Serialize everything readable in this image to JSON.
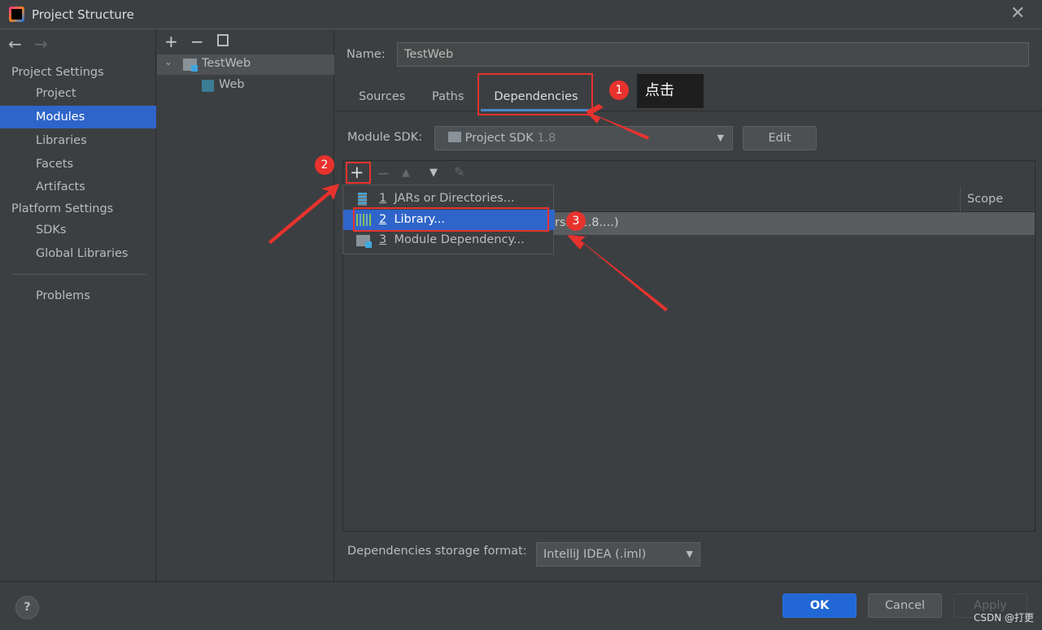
{
  "window": {
    "title": "Project Structure"
  },
  "sidebar": {
    "project_settings": "Project Settings",
    "items": [
      {
        "label": "Project"
      },
      {
        "label": "Modules"
      },
      {
        "label": "Libraries"
      },
      {
        "label": "Facets"
      },
      {
        "label": "Artifacts"
      }
    ],
    "platform_settings": "Platform Settings",
    "platform_items": [
      {
        "label": "SDKs"
      },
      {
        "label": "Global Libraries"
      }
    ],
    "problems": "Problems"
  },
  "tree": {
    "root": "TestWeb",
    "child": "Web"
  },
  "main": {
    "name_label": "Name:",
    "name_value": "TestWeb",
    "tabs": [
      {
        "label": "Sources"
      },
      {
        "label": "Paths"
      },
      {
        "label": "Dependencies"
      }
    ],
    "sdk_label": "Module SDK:",
    "sdk_value": "Project SDK",
    "sdk_version": "1.8",
    "edit": "Edit",
    "scope_header": "Scope",
    "row_text": "rsi   1.8....)",
    "storage_label": "Dependencies storage format:",
    "storage_value": "IntelliJ IDEA (.iml)"
  },
  "popup": {
    "items": [
      {
        "num": "1",
        "label": "JARs or Directories..."
      },
      {
        "num": "2",
        "label": "Library..."
      },
      {
        "num": "3",
        "label": "Module Dependency..."
      }
    ]
  },
  "annotations": {
    "b1": "1",
    "b2": "2",
    "b3": "3",
    "note": "点击",
    "color": "#e8322e"
  },
  "footer": {
    "ok": "OK",
    "cancel": "Cancel",
    "apply": "Apply",
    "help": "?",
    "watermark": "CSDN @打更"
  }
}
